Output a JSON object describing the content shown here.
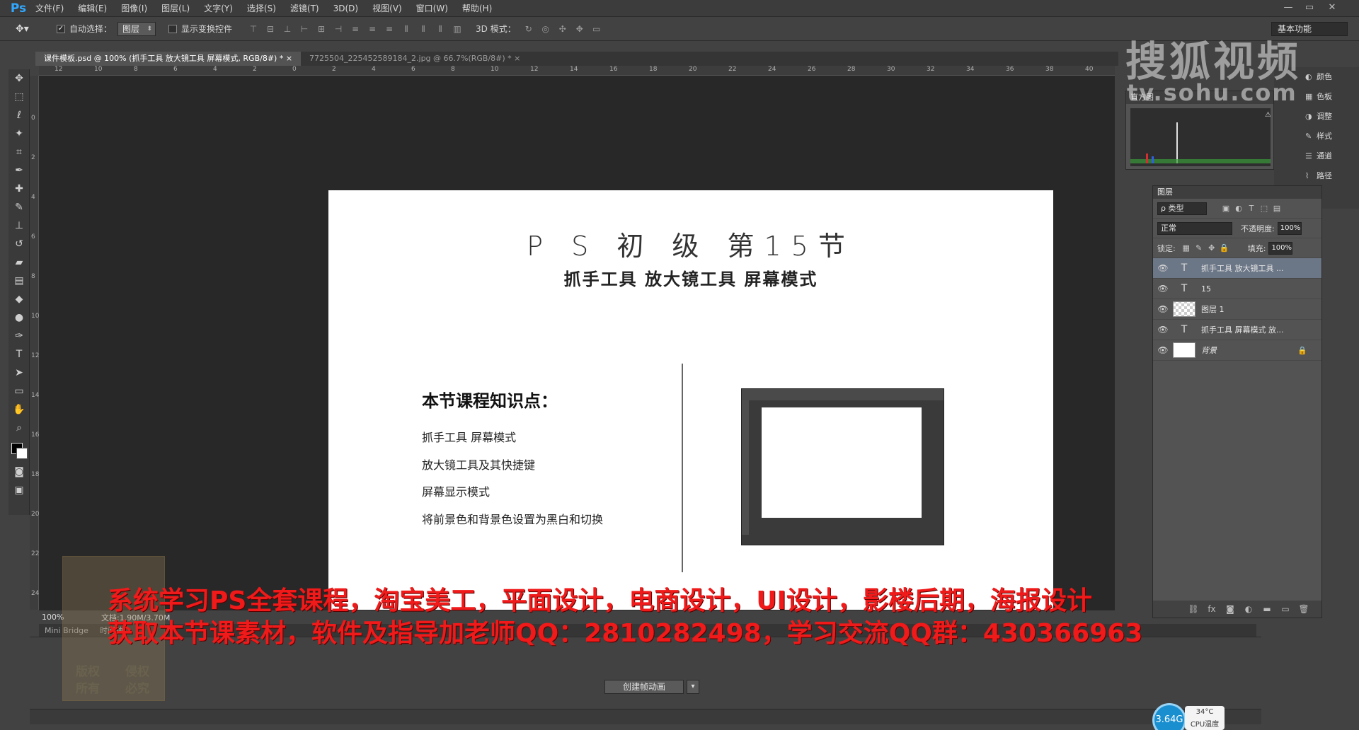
{
  "app": {
    "logo": "Ps"
  },
  "menu": [
    "文件(F)",
    "编辑(E)",
    "图像(I)",
    "图层(L)",
    "文字(Y)",
    "选择(S)",
    "滤镜(T)",
    "3D(D)",
    "视图(V)",
    "窗口(W)",
    "帮助(H)"
  ],
  "window_controls": [
    "—",
    "▭",
    "✕"
  ],
  "options": {
    "auto_select_label": "自动选择：",
    "auto_select_checked": true,
    "auto_select_value": "图层",
    "show_transform_label": "显示变换控件",
    "mode_3d_label": "3D 模式：",
    "workspace": "基本功能"
  },
  "tabs": [
    {
      "label": "课件模板.psd @ 100% (抓手工具  放大镜工具  屏幕模式, RGB/8#) * ×"
    },
    {
      "label": "7725504_225452589184_2.jpg @ 66.7%(RGB/8#) * ×"
    }
  ],
  "ruler_top": [
    "12",
    "10",
    "8",
    "6",
    "4",
    "2",
    "0",
    "2",
    "4",
    "6",
    "8",
    "10",
    "12",
    "14",
    "16",
    "18",
    "20",
    "22",
    "24",
    "26",
    "28",
    "30",
    "32",
    "34",
    "36",
    "38",
    "40"
  ],
  "ruler_left": [
    "0",
    "2",
    "4",
    "6",
    "8",
    "10",
    "12",
    "14",
    "16",
    "18",
    "20",
    "22",
    "24"
  ],
  "document": {
    "title": "P S 初 级 第15节",
    "subtitle": "抓手工具  放大镜工具  屏幕模式",
    "heading": "本节课程知识点：",
    "items": [
      "抓手工具   屏幕模式",
      "放大镜工具及其快捷键",
      "屏幕显示模式",
      "将前景色和背景色设置为黑白和切换"
    ]
  },
  "status": {
    "zoom": "100%",
    "doc_size": "文档:1.90M/3.70M"
  },
  "timeline": {
    "tabs": [
      "Mini Bridge",
      "时间轴"
    ],
    "create_button": "创建帧动画"
  },
  "histogram": {
    "tab": "直方图"
  },
  "right_labels": [
    {
      "icon": "◐",
      "label": "颜色"
    },
    {
      "icon": "▦",
      "label": "色板"
    },
    {
      "icon": "◑",
      "label": "调整"
    },
    {
      "icon": "✎",
      "label": "样式"
    },
    {
      "icon": "☰",
      "label": "通道"
    },
    {
      "icon": "⌇",
      "label": "路径"
    }
  ],
  "layers": {
    "tab": "图层",
    "filter_kind": "ρ 类型",
    "blend_mode": "正常",
    "opacity_label": "不透明度:",
    "opacity": "100%",
    "lock_label": "锁定:",
    "fill_label": "填充:",
    "fill": "100%",
    "items": [
      {
        "name": "抓手工具 放大镜工具 ...",
        "type": "text",
        "selected": true
      },
      {
        "name": "15",
        "type": "text",
        "selected": false
      },
      {
        "name": "图层 1",
        "type": "image",
        "selected": false
      },
      {
        "name": "抓手工具  屏幕模式 放...",
        "type": "text",
        "selected": false
      },
      {
        "name": "背景",
        "type": "background",
        "selected": false,
        "locked": true
      }
    ]
  },
  "watermark": {
    "brand": "搜狐视频",
    "url": "tv.sohu.com"
  },
  "promo": {
    "line1": "系统学习PS全套课程，淘宝美工，平面设计，电商设计，UI设计，影楼后期，海报设计",
    "line2": "获取本节课素材，软件及指导加老师QQ：2810282498，学习交流QQ群：430366963"
  },
  "stamp": {
    "t1": "版权",
    "t2": "侵权",
    "t3": "所有",
    "t4": "必究"
  },
  "cpu": {
    "usage": "3.64G",
    "temp": "34°C",
    "label": "CPU温度"
  }
}
